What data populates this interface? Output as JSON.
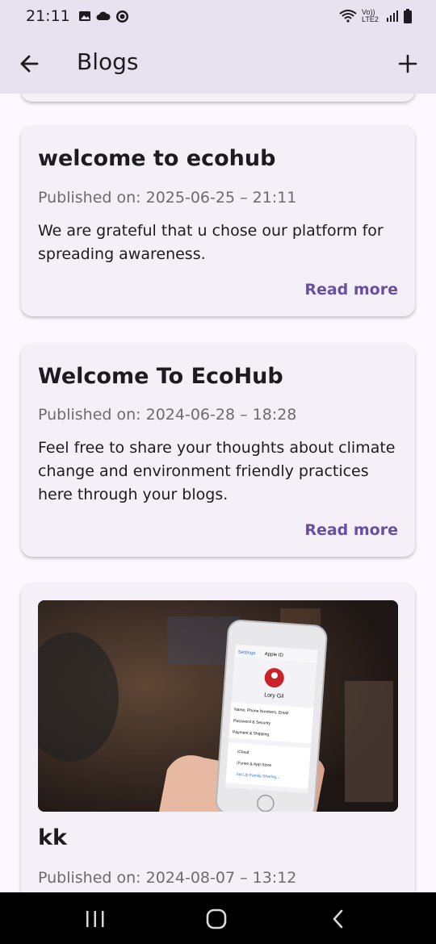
{
  "status_bar": {
    "time": "21:11",
    "network_label": "Vo)) LTE2"
  },
  "app_bar": {
    "title": "Blogs",
    "back_icon": "arrow-left-icon",
    "add_icon": "plus-icon"
  },
  "blogs": [
    {
      "title": "welcome to ecohub",
      "published": "Published on: 2025-06-25 – 21:11",
      "body": "We are grateful that u chose our platform for spreading awareness.",
      "read_more": "Read more"
    },
    {
      "title": "Welcome To EcoHub",
      "published": "Published on: 2024-06-28 – 18:28",
      "body": "Feel free to share your thoughts about climate change and environment friendly practices here through your blogs.",
      "read_more": "Read more"
    },
    {
      "title": "kk",
      "published": "Published on: 2024-08-07 – 13:12",
      "image_alt": "photo of a hand holding a phone",
      "image_screen": {
        "header_left": "Settings",
        "header_title": "Apple ID",
        "name": "Lory Gil",
        "rows": [
          "Name, Phone Numbers, Email",
          "Password & Security",
          "Payment & Shipping",
          "iCloud",
          "iTunes & App Store",
          "Set Up Family Sharing..."
        ]
      }
    }
  ],
  "colors": {
    "accent": "#6750a4",
    "app_bar_bg": "#e8e1f0",
    "card_bg": "#f5eff7",
    "page_bg": "#fdf7ff"
  }
}
